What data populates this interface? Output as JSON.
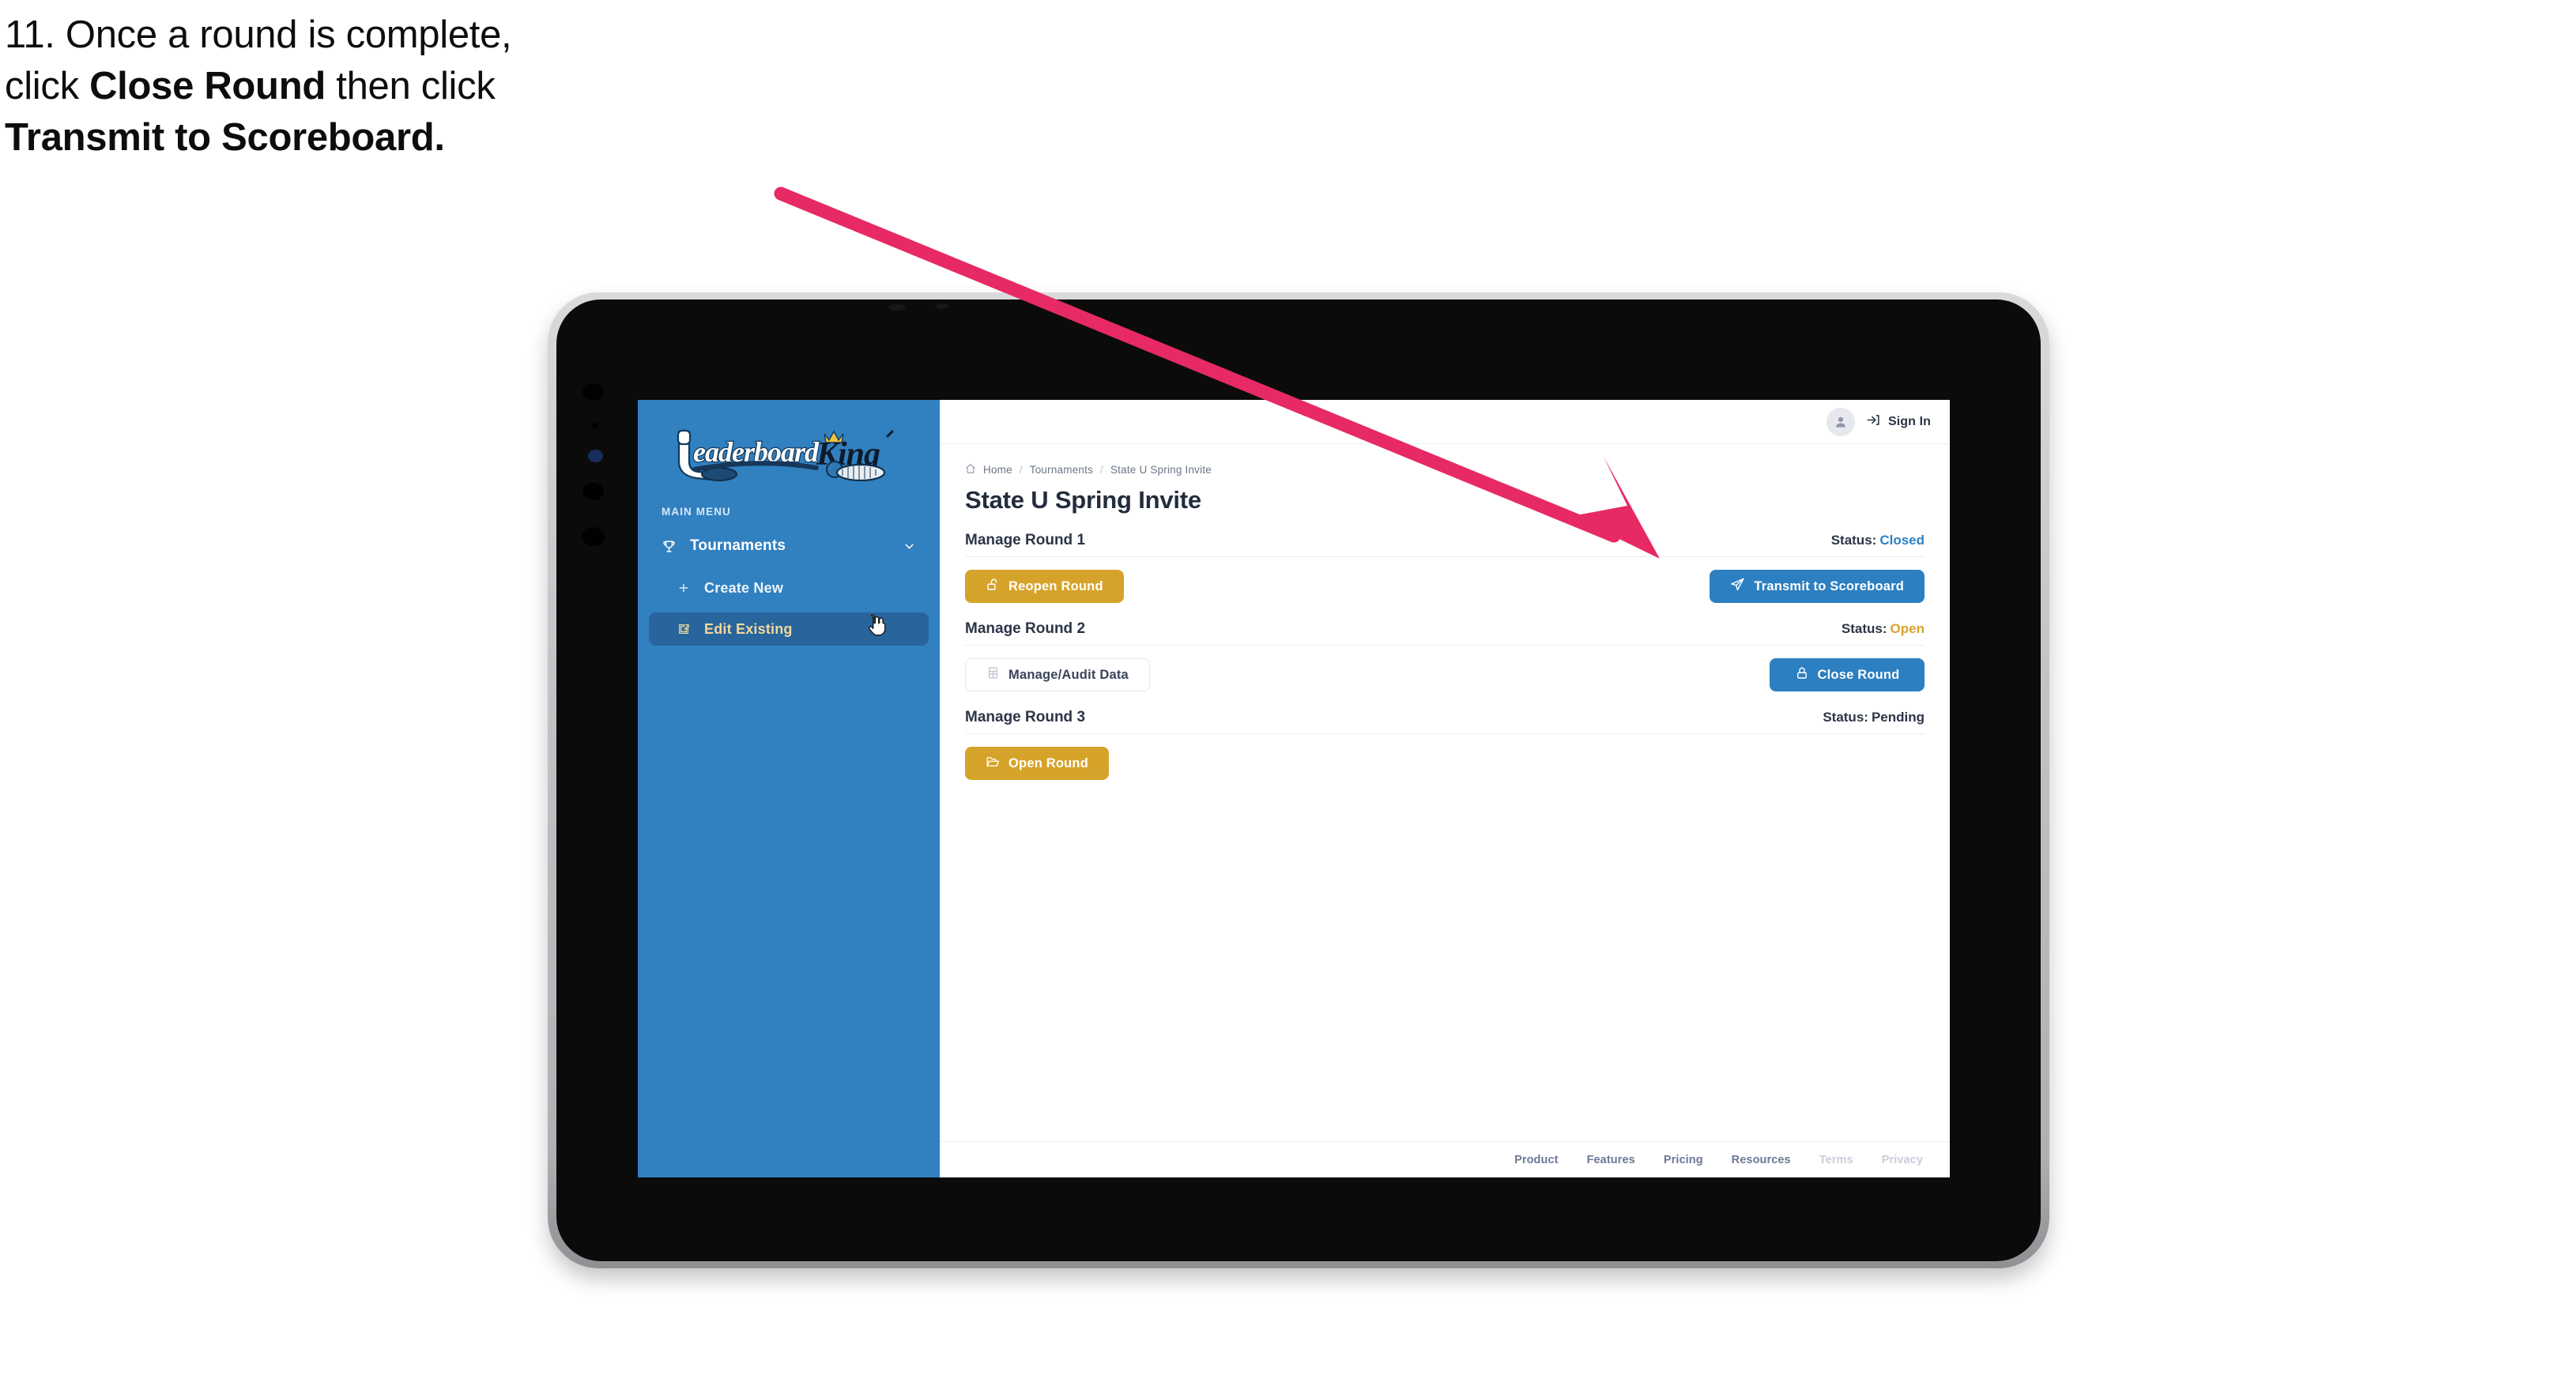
{
  "caption": {
    "line1_plain": "11. Once a round is complete,",
    "line2_pre": "click ",
    "line2_bold": "Close Round",
    "line2_post": " then click",
    "line3_bold": "Transmit to Scoreboard."
  },
  "annotation": {
    "arrow_color": "#E72A63",
    "arrow_name": "pointer-arrow-to-transmit-button"
  },
  "sidebar": {
    "logo_text_left": "Leaderboard",
    "logo_text_right": "King",
    "section_label": "MAIN MENU",
    "nav": {
      "label": "Tournaments",
      "icon": "trophy-icon",
      "chevron": "chevron-down-icon"
    },
    "items": [
      {
        "label": "Create New",
        "icon": "plus-icon",
        "active": false
      },
      {
        "label": "Edit Existing",
        "icon": "edit-square-icon",
        "active": true
      }
    ],
    "bg_color": "#3180C0",
    "active_bg_color": "#27659C",
    "active_text_color": "#F3D79A"
  },
  "topbar": {
    "avatar_icon": "user-avatar-icon",
    "signin_icon": "sign-in-arrow-icon",
    "signin_label": "Sign In"
  },
  "breadcrumb": {
    "home_icon": "home-icon",
    "items": [
      "Home",
      "Tournaments",
      "State U Spring Invite"
    ],
    "separator": "/"
  },
  "page": {
    "title": "State U Spring Invite"
  },
  "rounds": [
    {
      "name": "Manage Round 1",
      "status_label": "Status:",
      "status_value": "Closed",
      "status_class": "st-closed",
      "left_button": {
        "label": "Reopen Round",
        "icon": "unlock-icon",
        "style": "gold"
      },
      "right_button": {
        "label": "Transmit to Scoreboard",
        "icon": "paper-plane-icon",
        "style": "blue"
      }
    },
    {
      "name": "Manage Round 2",
      "status_label": "Status:",
      "status_value": "Open",
      "status_class": "st-open",
      "left_button": {
        "label": "Manage/Audit Data",
        "icon": "table-grid-icon",
        "style": "ghost"
      },
      "right_button": {
        "label": "Close Round",
        "icon": "lock-icon",
        "style": "blue"
      }
    },
    {
      "name": "Manage Round 3",
      "status_label": "Status:",
      "status_value": "Pending",
      "status_class": "st-pending",
      "left_button": {
        "label": "Open Round",
        "icon": "open-folder-icon",
        "style": "gold"
      },
      "right_button": null
    }
  ],
  "footer": {
    "links": [
      {
        "label": "Product",
        "dim": false
      },
      {
        "label": "Features",
        "dim": false
      },
      {
        "label": "Pricing",
        "dim": false
      },
      {
        "label": "Resources",
        "dim": false
      },
      {
        "label": "Terms",
        "dim": true
      },
      {
        "label": "Privacy",
        "dim": true
      }
    ]
  },
  "colors": {
    "brand_blue": "#3180C0",
    "button_blue": "#2C7FC0",
    "gold": "#D6A32A",
    "status_closed": "#2F80C2",
    "status_open": "#D9A12C",
    "arrow_pink": "#E72A63"
  }
}
